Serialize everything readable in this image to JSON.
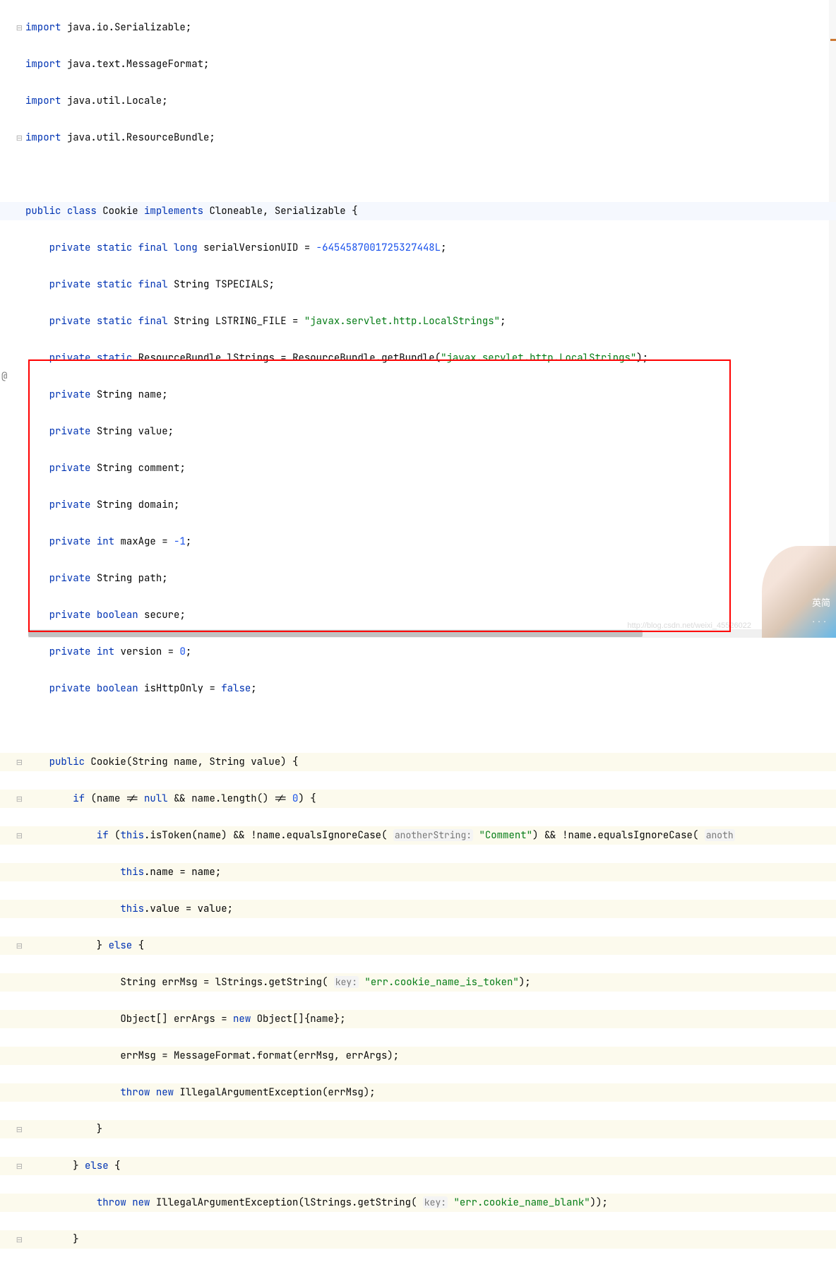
{
  "colors": {
    "keyword": "#0033b3",
    "string": "#067d17",
    "number": "#1750eb",
    "hint": "#787878"
  },
  "tokens": {
    "import": "import",
    "public": "public",
    "class": "class",
    "implements": "implements",
    "private": "private",
    "static": "static",
    "final": "final",
    "long": "long",
    "if": "if",
    "else": "else",
    "this": "this",
    "new": "new",
    "throw": "throw",
    "null": "null",
    "int": "int",
    "boolean": "boolean",
    "false": "false"
  },
  "imports": [
    "java.io.Serializable",
    "java.text.MessageFormat",
    "java.util.Locale",
    "java.util.ResourceBundle"
  ],
  "classDecl": {
    "name": "Cookie",
    "impl1": "Cloneable",
    "impl2": "Serializable"
  },
  "fields": {
    "uidName": "serialVersionUID",
    "uidVal": "-6454587001725327448L",
    "tspecials": "TSPECIALS",
    "lstringfile": "LSTRING_FILE",
    "lstringfileVal": "\"javax.servlet.http.LocalStrings\"",
    "lstrings": "lStrings",
    "rbClass": "ResourceBundle",
    "getBundle": "getBundle",
    "bundleArg": "\"javax.servlet.http.LocalStrings\"",
    "name": "name",
    "value": "value",
    "comment": "comment",
    "domain": "domain",
    "maxAge": "maxAge",
    "maxAgeVal": "-1",
    "path": "path",
    "secure": "secure",
    "version": "version",
    "versionVal": "0",
    "isHttpOnly": "isHttpOnly"
  },
  "ctor": {
    "sig": "Cookie(String name, String value)",
    "cond1": "(name != ",
    "cond1b": " && name.length() != ",
    "zero": "0",
    "cond2a": "this.isToken(name) && !name.equalsIgnoreCase(",
    "hint1": "anotherString:",
    "comment": "\"Comment\"",
    "cond2b": ") && !name.equalsIgnoreCase(",
    "hint2": "anoth",
    "assign1": "this.name = name;",
    "assign2": "this.value = value;",
    "errMsgDecl": "String errMsg = lStrings.getString(",
    "keyHint": "key:",
    "errToken": "\"err.cookie_name_is_token\"",
    "errArgs": "Object[] errArgs = ",
    "objNew": "Object[]{name};",
    "fmtLine": "errMsg = MessageFormat.format(errMsg, errArgs);",
    "throw1": "IllegalArgumentException(errMsg);",
    "throw2a": "IllegalArgumentException(lStrings.getString(",
    "errBlank": "\"err.cookie_name_blank\"",
    "throw2b": "));"
  },
  "watermark": "http://blog.csdn.net/weixi_45526022"
}
